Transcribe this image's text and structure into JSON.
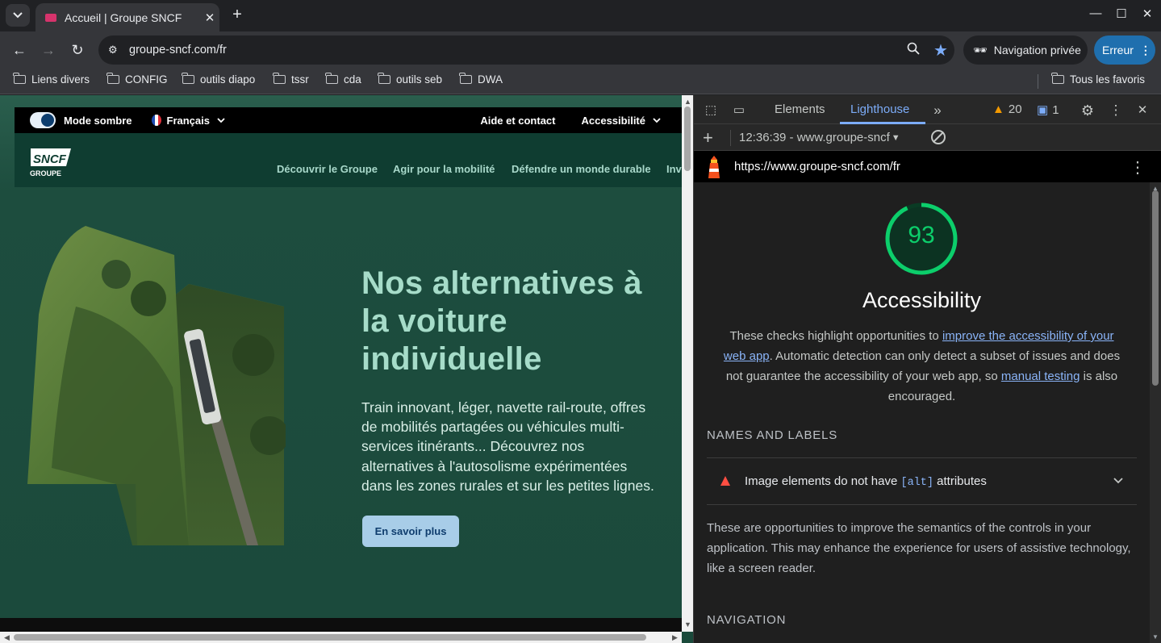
{
  "browser": {
    "tab_title": "Accueil | Groupe SNCF",
    "url": "groupe-sncf.com/fr",
    "incognito_label": "Navigation privée",
    "error_label": "Erreur",
    "bookmarks": [
      "Liens divers",
      "CONFIG",
      "outils diapo",
      "tssr",
      "cda",
      "outils seb",
      "DWA"
    ],
    "all_bookmarks_label": "Tous les favoris"
  },
  "site": {
    "dark_mode_label": "Mode sombre",
    "language": "Français",
    "help_link": "Aide et contact",
    "accessibility_menu": "Accessibilité",
    "logo_text": "SNCF",
    "logo_sub": "GROUPE",
    "nav": [
      "Découvrir le Groupe",
      "Agir pour la mobilité",
      "Défendre un monde durable",
      "Inv"
    ],
    "hero_title": "Nos alternatives à la voiture individuelle",
    "hero_desc": "Train innovant, léger, navette rail-route, offres de mobilités partagées ou véhicules multi-services itinérants... Découvrez nos alternatives à l'autosolisme expérimentées dans les zones rurales et sur les petites lignes.",
    "cta": "En savoir plus"
  },
  "devtools": {
    "tabs": [
      "Elements",
      "Lighthouse"
    ],
    "warnings_count": "20",
    "messages_count": "1",
    "report_select": "12:36:39 - www.groupe-sncf",
    "report_url": "https://www.groupe-sncf.com/fr",
    "score": 93,
    "category_title": "Accessibility",
    "desc_1": "These checks highlight opportunities to ",
    "desc_link_1": "improve the accessibility of your web app",
    "desc_2": ". Automatic detection can only detect a subset of issues and does not guarantee the accessibility of your web app, so ",
    "desc_link_2": "manual testing",
    "desc_3": " is also encouraged.",
    "group_1_title": "NAMES AND LABELS",
    "audit_1_pre": "Image elements do not have ",
    "audit_1_code": "[alt]",
    "audit_1_post": " attributes",
    "group_1_desc": "These are opportunities to improve the semantics of the controls in your application. This may enhance the experience for users of assistive technology, like a screen reader.",
    "group_2_title": "NAVIGATION",
    "colors": {
      "pass": "#0cce6b",
      "fail": "#ff4e42",
      "accent": "#7cacf8"
    }
  }
}
